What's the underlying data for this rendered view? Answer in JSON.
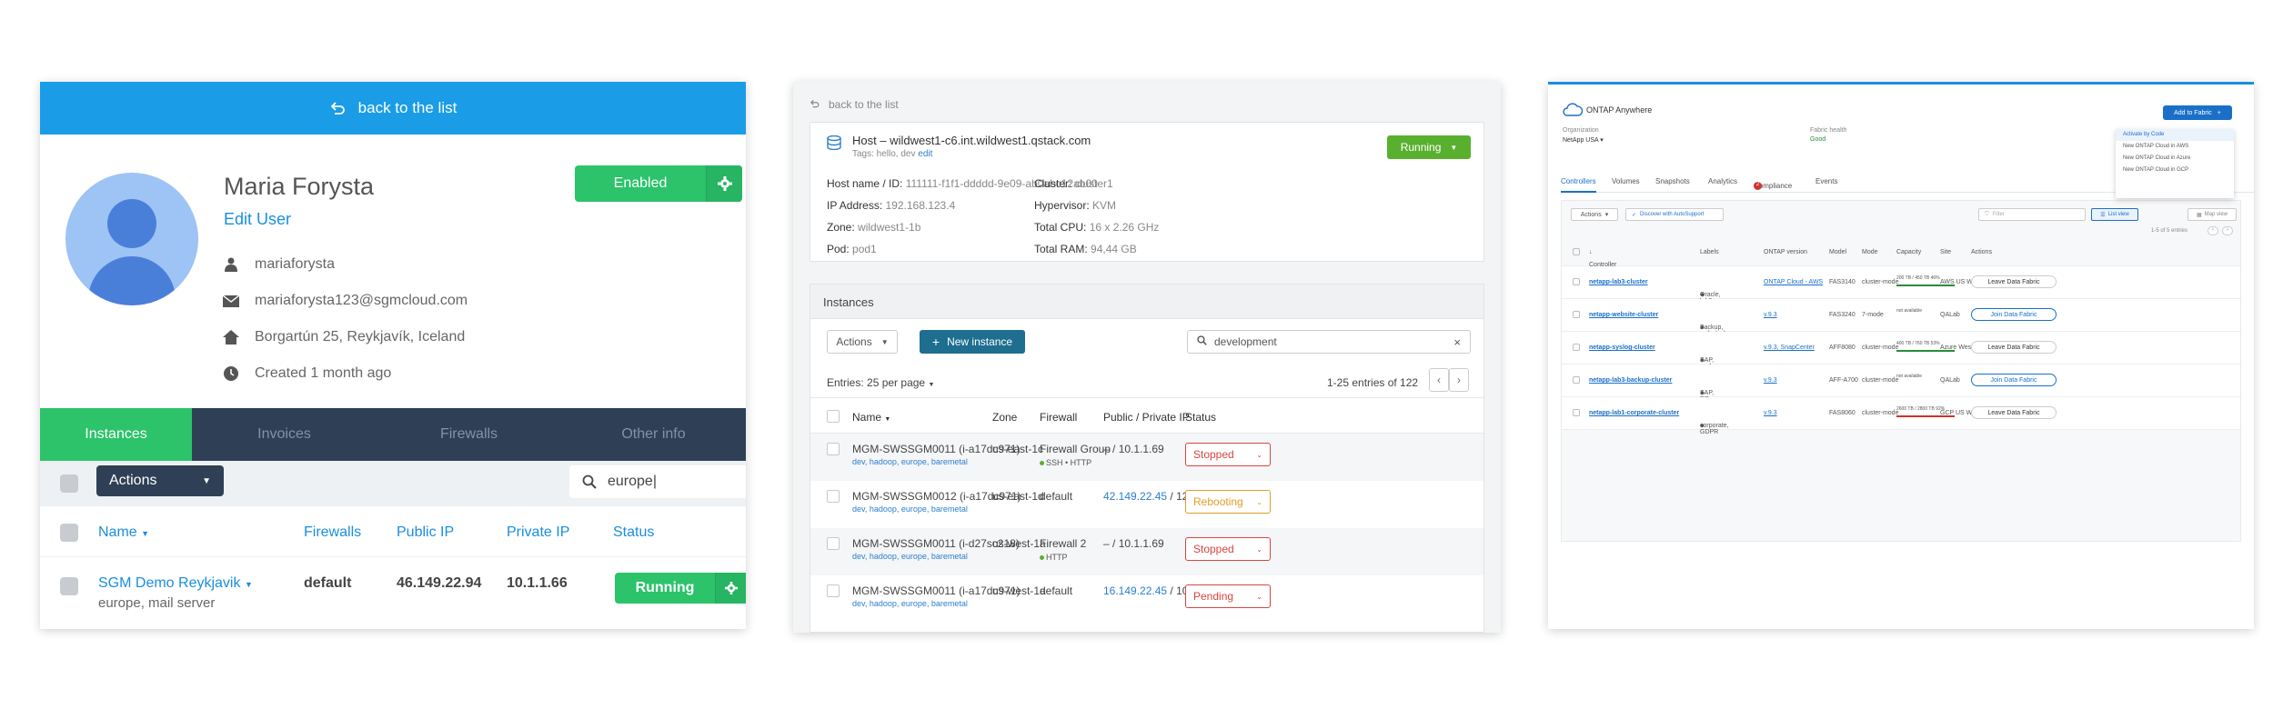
{
  "panel1": {
    "back": "back to the list",
    "name": "Maria Forysta",
    "edit": "Edit User",
    "username": "mariaforysta",
    "email": "mariaforysta123@sgmcloud.com",
    "address": "Borgartún 25, Reykjavík, Iceland",
    "created": "Created 1 month ago",
    "enabled": "Enabled",
    "tabs": [
      "Instances",
      "Invoices",
      "Firewalls",
      "Other info"
    ],
    "actions": "Actions",
    "search_value": "europe|",
    "columns": [
      "Name",
      "Firewalls",
      "Public IP",
      "Private IP",
      "Status"
    ],
    "row": {
      "name": "SGM Demo Reykjavik",
      "sub": "europe, mail server",
      "firewall": "default",
      "public_ip": "46.149.22.94",
      "private_ip": "10.1.1.66",
      "status": "Running"
    }
  },
  "panel2": {
    "back": "back to the list",
    "host_title": "Host – wildwest1-c6.int.wildwest1.qstack.com",
    "tags_label": "Tags: hello, dev",
    "tags_edit": "edit",
    "status": "Running",
    "details_left": [
      {
        "k": "Host name / ID:",
        "v": "111111-f1f1-ddddd-9e09-ab0abc12ab00"
      },
      {
        "k": "IP Address:",
        "v": "192.168.123.4"
      },
      {
        "k": "Zone:",
        "v": "wildwest1-1b"
      },
      {
        "k": "Pod:",
        "v": "pod1"
      }
    ],
    "details_right": [
      {
        "k": "Cluster:",
        "v": "cluster1"
      },
      {
        "k": "Hypervisor:",
        "v": "KVM"
      },
      {
        "k": "Total CPU:",
        "v": "16 x 2.26 GHz"
      },
      {
        "k": "Total RAM:",
        "v": "94,44 GB"
      }
    ],
    "instances_title": "Instances",
    "actions": "Actions",
    "new_instance": "New instance",
    "search_value": "development",
    "entries_label": "Entries:",
    "entries_value": "25 per page",
    "pagination": "1-25 entries of 122",
    "columns": [
      "Name",
      "Zone",
      "Firewall",
      "Public / Private IP",
      "Status"
    ],
    "rows": [
      {
        "name": "MGM-SWSSGM0011 (i-a17dc971)",
        "labels": "dev, hadoop, europe, baremetal",
        "zone": "us-east-1c",
        "firewall": "Firewall Group",
        "fw_sub": "SSH  • HTTP",
        "public": "–",
        "private": " / 10.1.1.69",
        "status": "Stopped"
      },
      {
        "name": "MGM-SWSSGM0012 (i-a17dc971)",
        "labels": "dev, hadoop, europe, baremetal",
        "zone": "us-east-1d",
        "firewall": "default",
        "fw_sub": "",
        "public": "42.149.22.45",
        "private": " / 12.1.1.07",
        "status": "Rebooting"
      },
      {
        "name": "MGM-SWSSGM0011 (i-d27sc218)",
        "labels": "dev, hadoop, europe, baremetal",
        "zone": "us-west-1a",
        "firewall": "Firewall 2",
        "fw_sub": "HTTP",
        "public": "–",
        "private": " / 10.1.1.69",
        "status": "Stopped"
      },
      {
        "name": "MGM-SWSSGM0011 (i-a17dc971)",
        "labels": "dev, hadoop, europe, baremetal",
        "zone": "us-west-1a",
        "firewall": "default",
        "fw_sub": "",
        "public": "16.149.22.45",
        "private": " / 10.1.1.69",
        "status": "Pending"
      }
    ]
  },
  "panel3": {
    "app_title": "ONTAP Anywhere",
    "org_label": "Organization",
    "org_value": "NetApp USA",
    "health_label": "Fabric health",
    "health_value": "Good",
    "add_button": "Add to Fabric",
    "dropdown": [
      "Activate by Code",
      "New ONTAP Cloud in AWS",
      "New ONTAP Cloud in Azure",
      "New ONTAP Cloud in GCP"
    ],
    "tabs": [
      "Controllers",
      "Volumes",
      "Snapshots",
      "Analytics",
      "Compliance",
      "Events"
    ],
    "compliance_badge": "2",
    "actions": "Actions",
    "autosupport": "Discover with AutoSupport",
    "filter_placeholder": "Filter",
    "list_view": "List view",
    "map_view": "Map view",
    "pager": "1-5 of 5 entries",
    "columns": [
      "Controller",
      "Labels",
      "ONTAP version",
      "Model",
      "Mode",
      "Capacity",
      "Site",
      "Actions"
    ],
    "rows": [
      {
        "controller": "netapp-lab3-cluster",
        "labels": "Oracle, lab3, corporate",
        "version": "ONTAP Cloud - AWS",
        "model": "FAS3140",
        "mode": "cluster-mode",
        "capacity": "200 TB / 450 TB 46%",
        "site": "AWS US West 1",
        "action": "Leave Data Fabric",
        "bar": "#2a8a3a"
      },
      {
        "controller": "netapp-website-cluster",
        "labels": "Backup, websitedev",
        "version": "v.9.3",
        "model": "FAS3240",
        "mode": "7-mode",
        "capacity": "not available",
        "site": "QALab",
        "action": "Join Data Fabric",
        "bar": ""
      },
      {
        "controller": "netapp-syslog-cluster",
        "labels": "SAP, syslog-server, devops",
        "version": "v.9.3, SnapCenter",
        "model": "AFF8080",
        "mode": "cluster-mode",
        "capacity": "400 TB / 760 TB 53%",
        "site": "Azure West US",
        "action": "Leave Data Fabric",
        "bar": "#2a8a3a"
      },
      {
        "controller": "netapp-lab3-backup-cluster",
        "labels": "SAP, DR-Site-1, lab3",
        "version": "v.9.3",
        "model": "AFF-A700",
        "mode": "cluster-mode",
        "capacity": "not available",
        "site": "QALab",
        "action": "Join Data Fabric",
        "bar": ""
      },
      {
        "controller": "netapp-lab1-corporate-cluster",
        "labels": "corporate, GDPR",
        "version": "v.9.3",
        "model": "FAS8060",
        "mode": "cluster-mode",
        "capacity": "2600 TB / 2800 TB 92%",
        "site": "GCP US West 1",
        "action": "Leave Data Fabric",
        "bar": "#d0342c"
      }
    ]
  }
}
